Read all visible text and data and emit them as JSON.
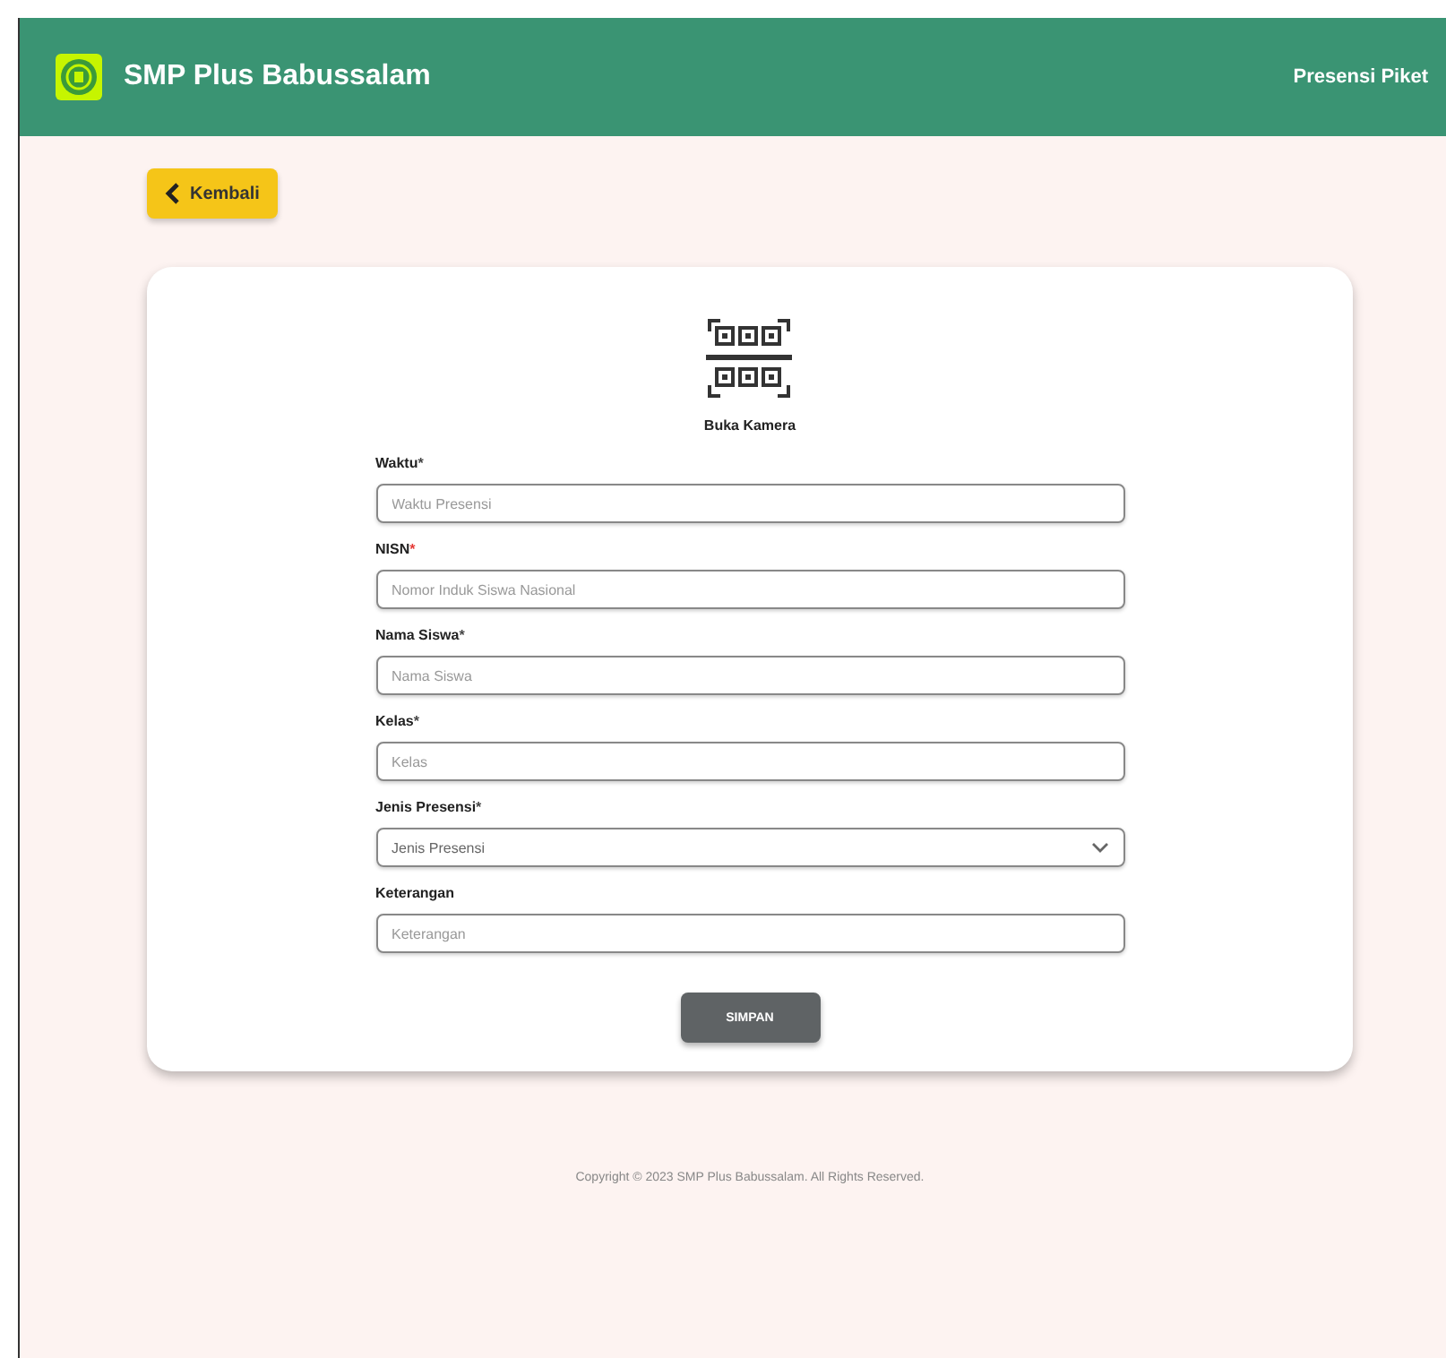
{
  "header": {
    "title": "SMP Plus Babussalam",
    "nav_link": "Presensi Piket"
  },
  "back_button": {
    "label": "Kembali"
  },
  "scanner": {
    "label": "Buka Kamera"
  },
  "fields": [
    {
      "kind": "text",
      "label": "Waktu",
      "asterisk": "*",
      "color": "#444444",
      "placeholder": "Waktu Presensi"
    },
    {
      "kind": "text",
      "label": "NISN",
      "asterisk": "*",
      "color": "#e53935",
      "placeholder": "Nomor Induk Siswa Nasional"
    },
    {
      "kind": "text",
      "label": "Nama Siswa",
      "asterisk": "*",
      "color": "#444444",
      "placeholder": "Nama Siswa"
    },
    {
      "kind": "text",
      "label": "Kelas",
      "asterisk": "*",
      "color": "#444444",
      "placeholder": "Kelas"
    },
    {
      "kind": "select",
      "label": "Jenis Presensi",
      "asterisk": "*",
      "color": "#444444",
      "placeholder": "Jenis Presensi"
    },
    {
      "kind": "text",
      "label": "Keterangan",
      "placeholder": "Keterangan"
    }
  ],
  "submit_button": {
    "label": "SIMPAN"
  },
  "footer": "Copyright © 2023 SMP Plus Babussalam. All Rights Reserved."
}
